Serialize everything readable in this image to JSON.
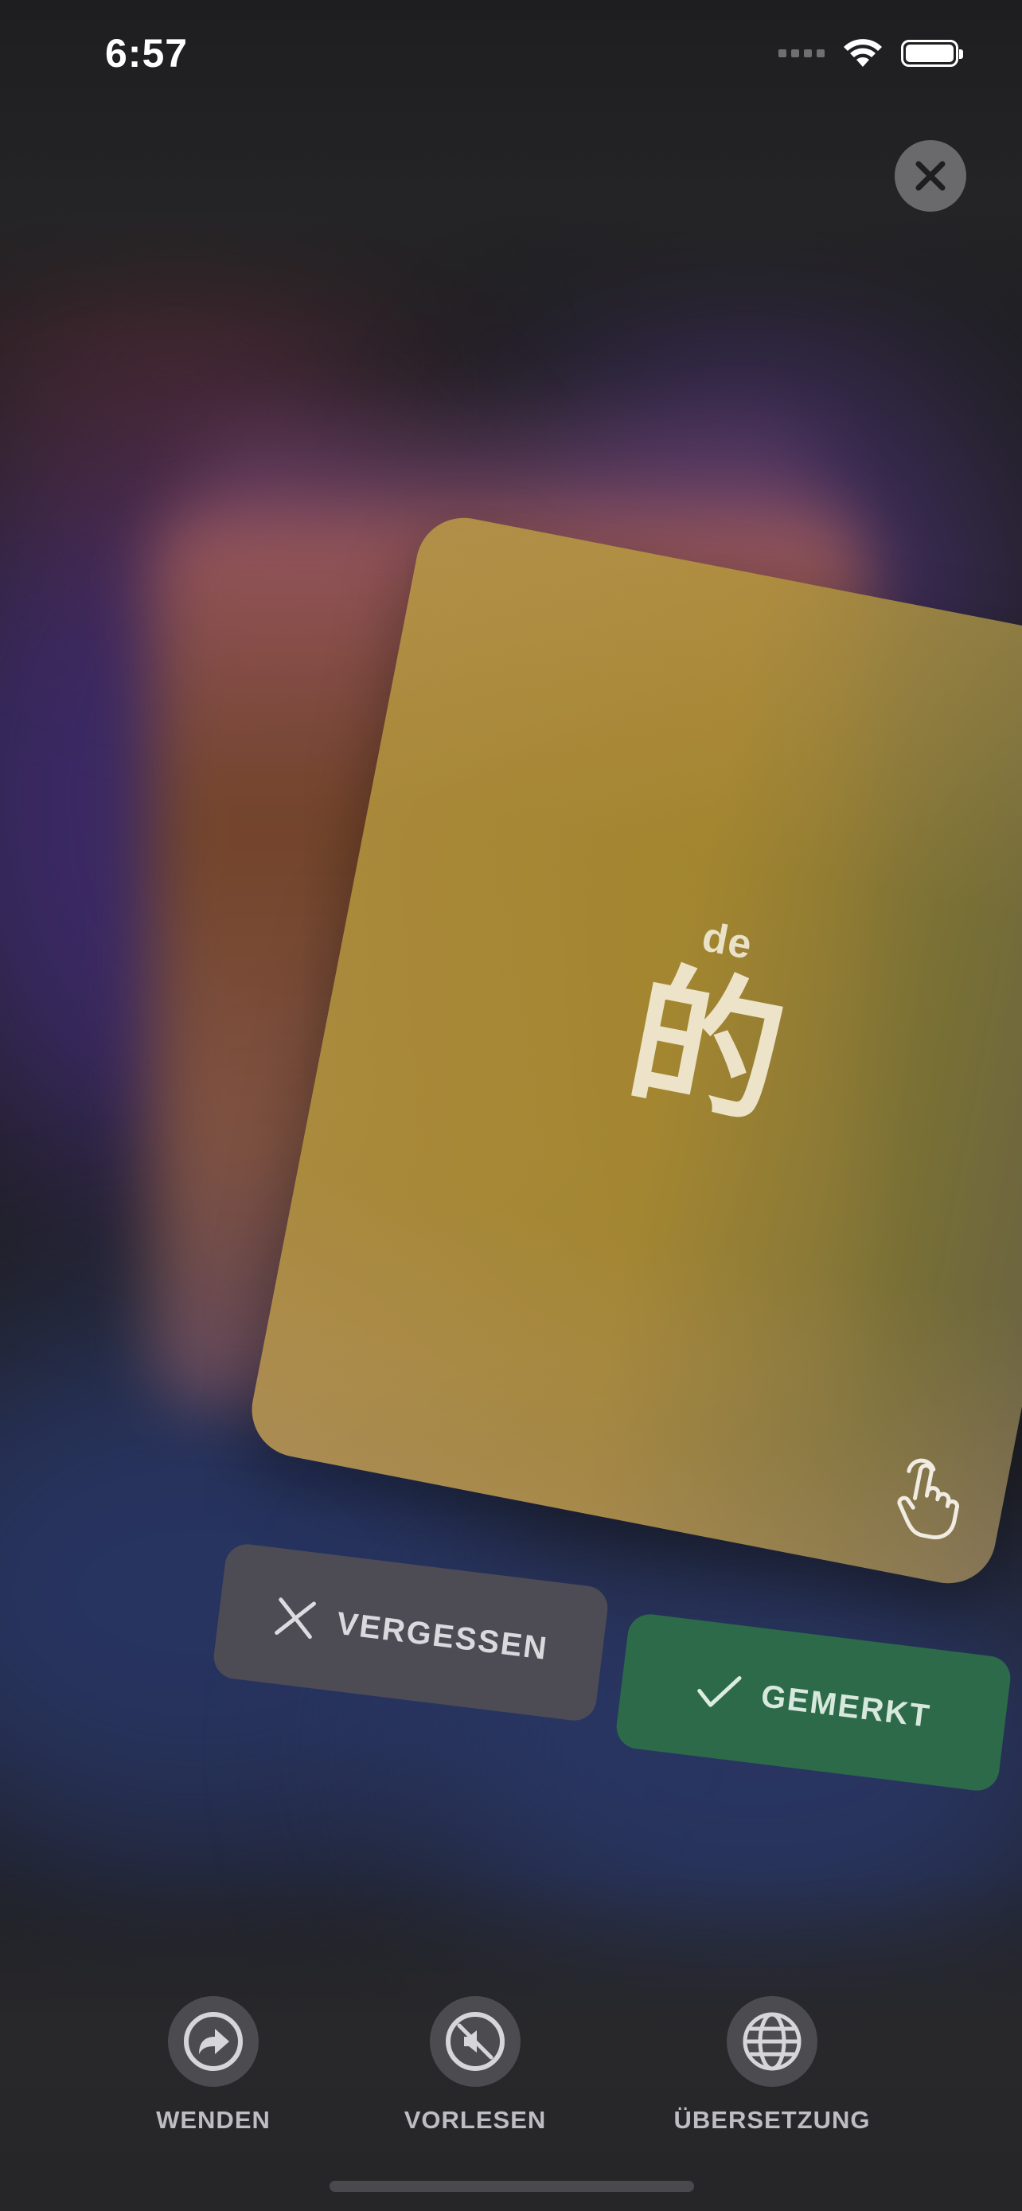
{
  "status_bar": {
    "time": "6:57",
    "icons": [
      "cellular-signal-icon",
      "wifi-icon",
      "battery-icon"
    ]
  },
  "close_button": {
    "icon": "close-icon"
  },
  "card": {
    "pinyin": "de",
    "hanzi": "的",
    "hint_icon": "tap-hand-icon",
    "color": "#b0923c"
  },
  "actions": {
    "forgot": {
      "label": "VERGESSEN",
      "icon": "x-icon",
      "color": "#4d4c55"
    },
    "known": {
      "label": "GEMERKT",
      "icon": "checkmark-icon",
      "color": "#2c6a4a"
    }
  },
  "toolbar": {
    "items": [
      {
        "label": "WENDEN",
        "icon": "turn-arrow-icon"
      },
      {
        "label": "VORLESEN",
        "icon": "speaker-muted-icon"
      },
      {
        "label": "ÜBERSETZUNG",
        "icon": "globe-icon"
      }
    ]
  }
}
